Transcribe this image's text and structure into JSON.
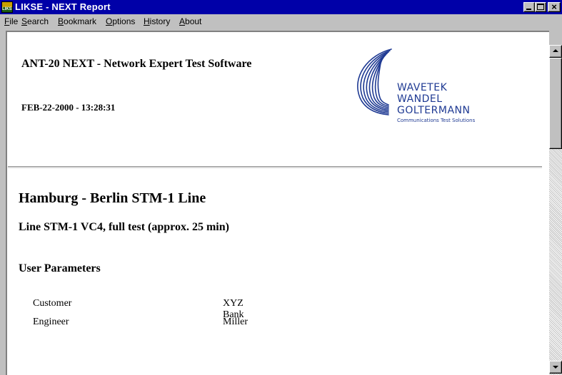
{
  "window": {
    "title": "LIKSE - NEXT Report",
    "icon_label": "LIKSE",
    "controls": {
      "minimize": "",
      "maximize": "",
      "close": "×"
    }
  },
  "menu": {
    "items": [
      {
        "label": "File",
        "accel": "F",
        "rest": "ile"
      },
      {
        "label": "Search",
        "accel": "S",
        "rest": "earch"
      },
      {
        "label": "Bookmark",
        "accel": "B",
        "rest": "ookmark"
      },
      {
        "label": "Options",
        "accel": "O",
        "rest": "ptions"
      },
      {
        "label": "History",
        "accel": "H",
        "rest": "istory"
      },
      {
        "label": "About",
        "accel": "A",
        "rest": "bout"
      }
    ]
  },
  "report": {
    "product": "ANT-20 NEXT - Network Expert Test Software",
    "datetime": "FEB-22-2000 - 13:28:31",
    "logo": {
      "line1": "WAVETEK",
      "line2": "WANDEL",
      "line3": "GOLTERMANN",
      "tagline": "Communications Test Solutions",
      "color": "#1f3a93"
    },
    "route": "Hamburg - Berlin STM-1 Line",
    "test": "Line STM-1 VC4, full test (approx. 25 min)",
    "params_heading": "User Parameters",
    "params": [
      {
        "key": "Customer",
        "value": "XYZ Bank"
      },
      {
        "key": "Engineer",
        "value": "Miller"
      }
    ]
  },
  "colors": {
    "titlebar": "#0000a8",
    "chrome": "#c0c0c0"
  }
}
